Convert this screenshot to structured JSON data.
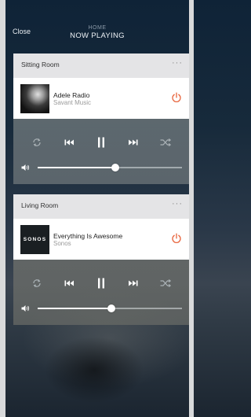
{
  "header": {
    "close_label": "Close",
    "subtitle": "HOME",
    "title": "NOW PLAYING"
  },
  "rooms": [
    {
      "name": "Room header",
      "room_label": "Sitting Room",
      "more_label": "···",
      "track": "Adele Radio",
      "source": "Savant Music",
      "album_art": "adele-portrait",
      "volume_fraction": 0.54,
      "playback_state": "playing"
    },
    {
      "room_label": "Living Room",
      "more_label": "···",
      "track": "Everything Is Awesome",
      "source": "Sonos",
      "album_art": "sonos-logo",
      "album_art_text": "SONOS",
      "volume_fraction": 0.51,
      "playback_state": "playing"
    }
  ],
  "icons": {
    "repeat": "repeat-icon",
    "previous": "previous-track-icon",
    "pause": "pause-icon",
    "next": "next-track-icon",
    "shuffle": "shuffle-icon",
    "volume": "speaker-icon",
    "power": "power-icon"
  },
  "colors": {
    "accent_power": "#e8643c",
    "header_bg": "#e4e4e6",
    "row_bg": "#ffffff"
  }
}
